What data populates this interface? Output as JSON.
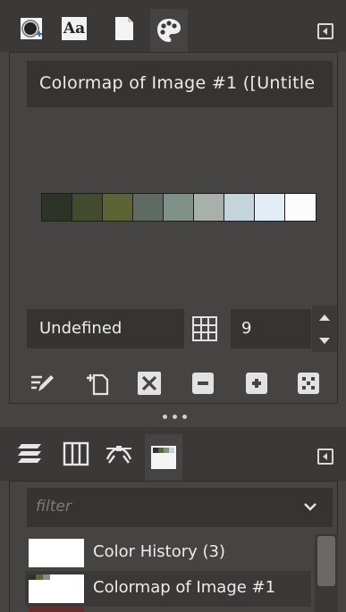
{
  "top_tabs": [
    {
      "name": "brushes",
      "icon": "brush-icon"
    },
    {
      "name": "fonts",
      "icon": "font-icon",
      "label": "Aa"
    },
    {
      "name": "document",
      "icon": "document-icon"
    },
    {
      "name": "colormap",
      "icon": "palette-icon",
      "active": true
    }
  ],
  "colormap": {
    "title": "Colormap of Image #1 ([Untitle",
    "swatches": [
      "#2c3428",
      "#434b2e",
      "#5b6432",
      "#5e6b61",
      "#7f9089",
      "#a7b0ab",
      "#c5d4db",
      "#e3edf7",
      "#fbfcfd"
    ],
    "index_label": "Undefined",
    "columns_value": "9"
  },
  "actions": [
    "edit-color",
    "new-color",
    "delete-color",
    "zoom-out",
    "zoom-in",
    "zoom-fit"
  ],
  "bottom_tabs": [
    {
      "name": "layers",
      "icon": "layers-icon"
    },
    {
      "name": "channels",
      "icon": "channels-icon"
    },
    {
      "name": "paths",
      "icon": "paths-icon"
    },
    {
      "name": "palettes",
      "icon": "palettes-icon",
      "active": true
    }
  ],
  "filter": {
    "placeholder": "filter"
  },
  "palette_list": [
    {
      "label": "Color History (3)"
    },
    {
      "label": "Colormap of Image #1"
    }
  ]
}
